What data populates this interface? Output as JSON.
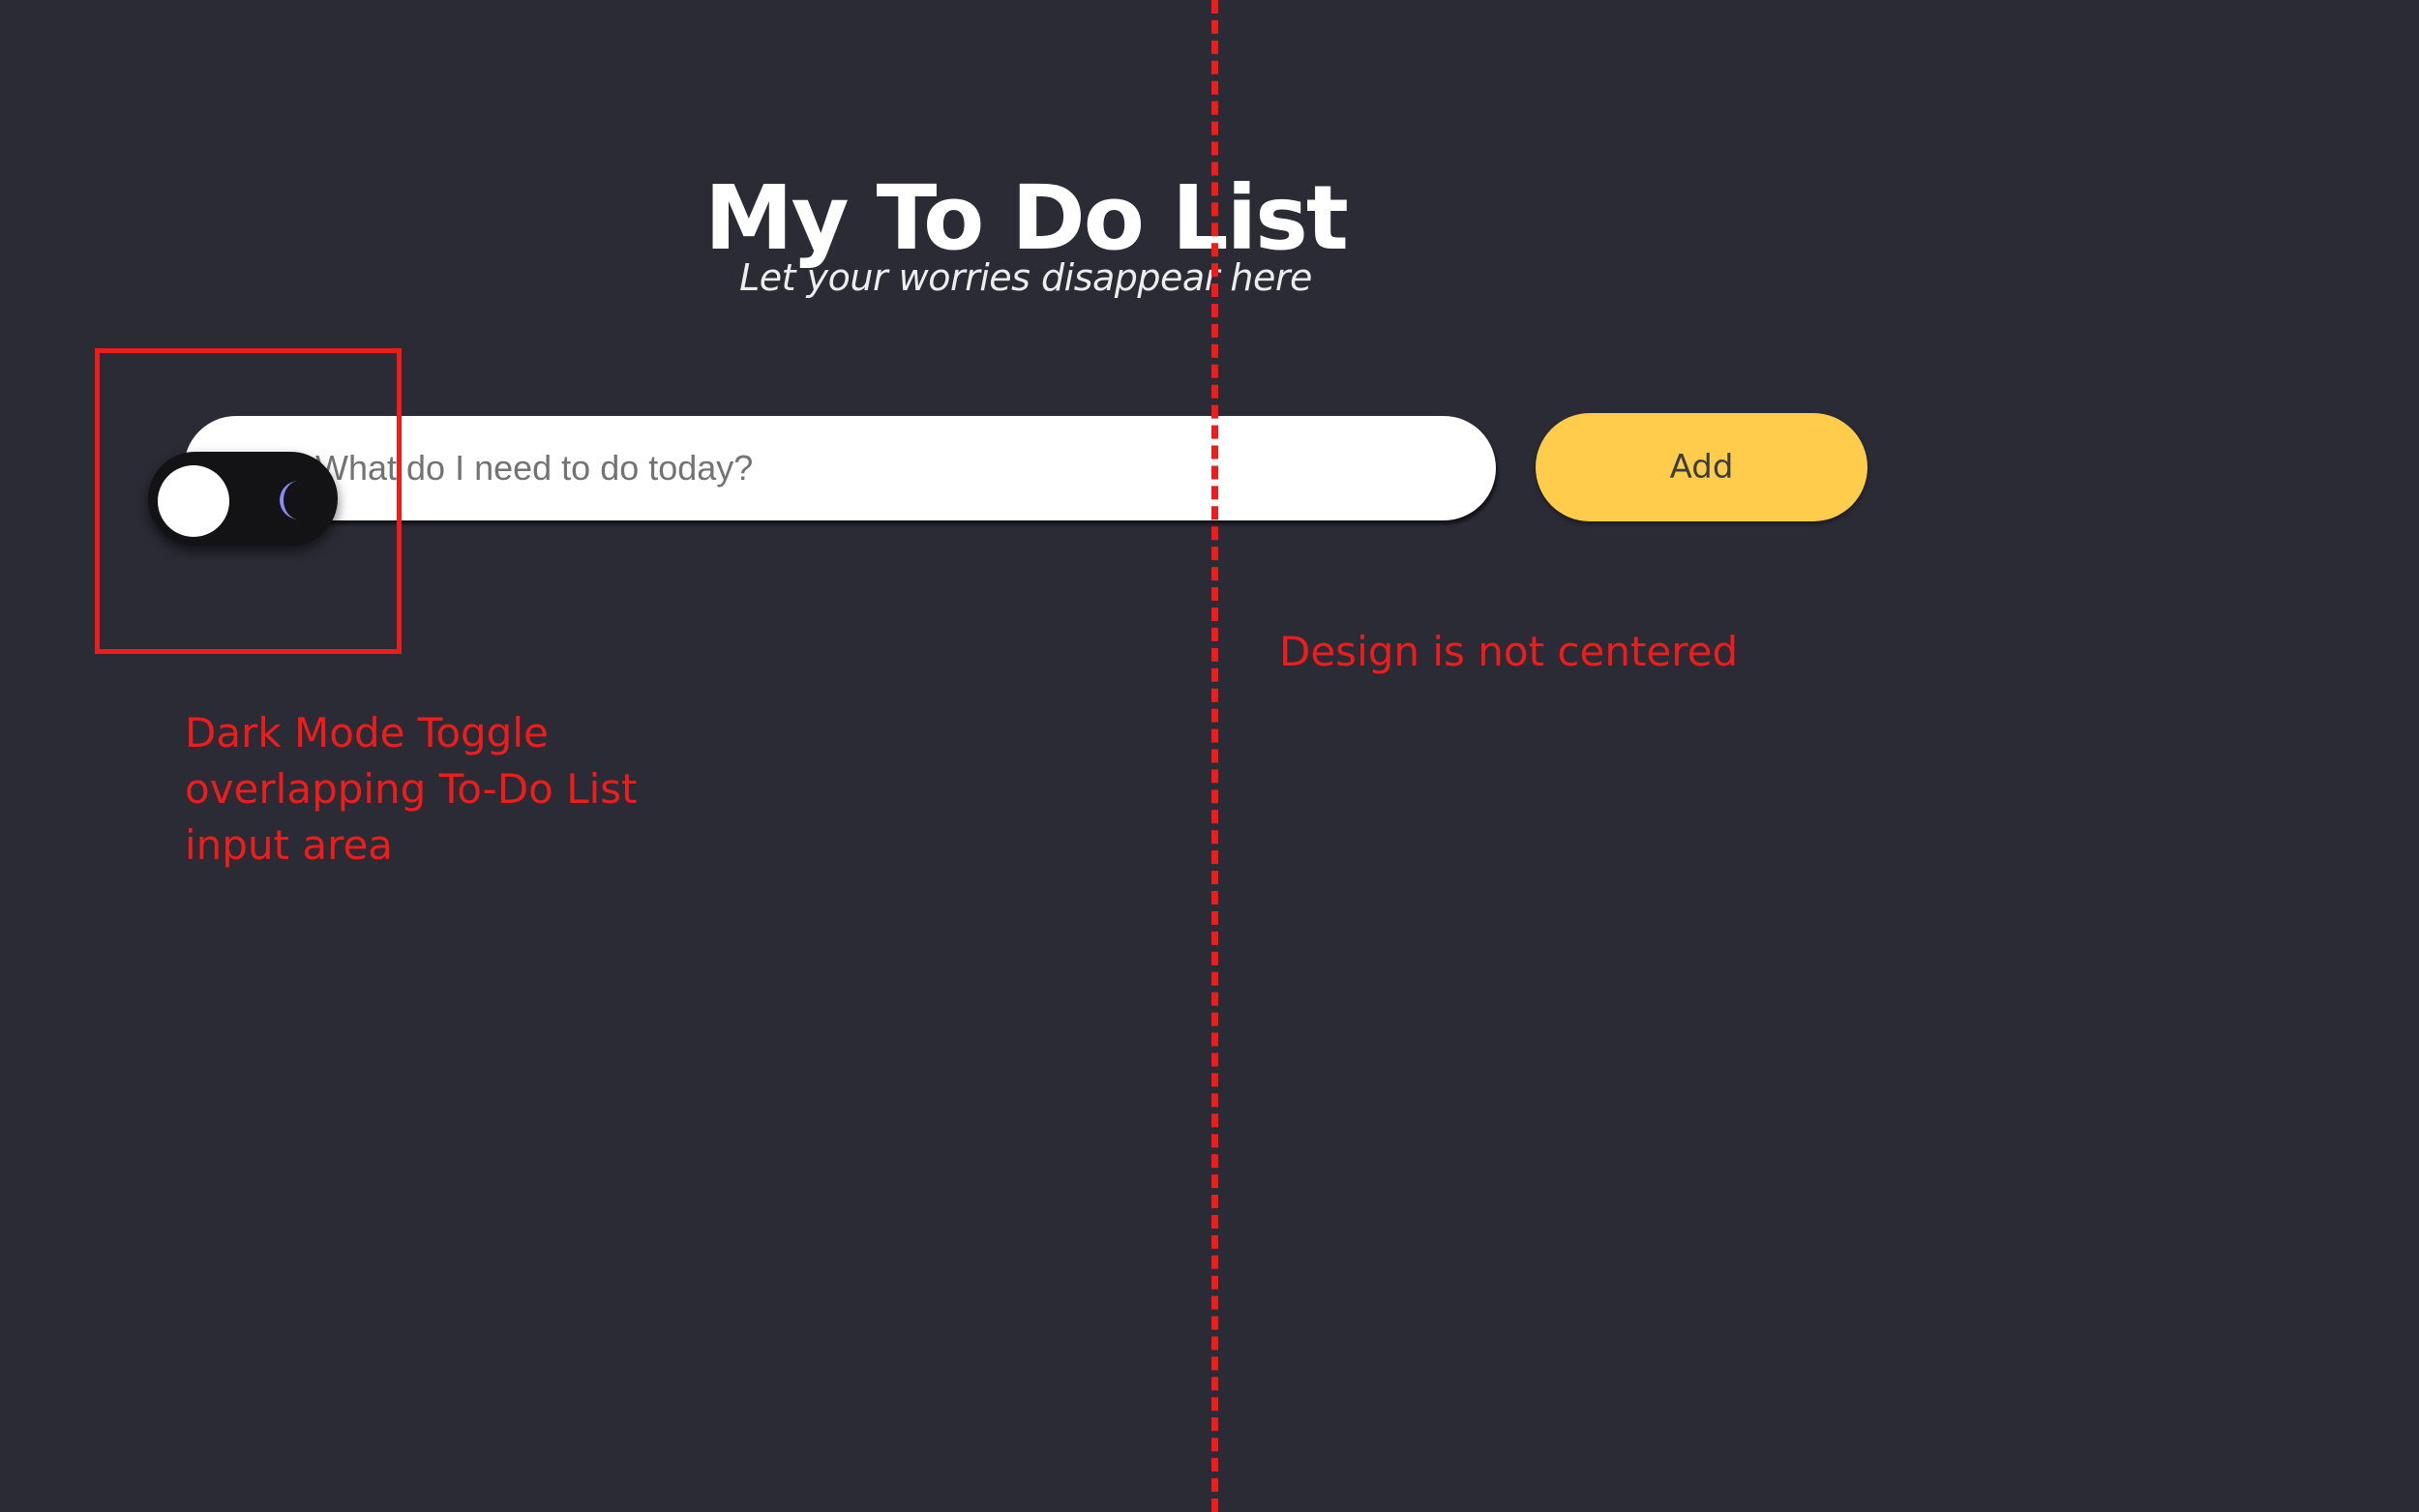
{
  "header": {
    "title": "My To Do List",
    "subtitle": "Let your worries disappear here"
  },
  "todo_form": {
    "input_placeholder": "What do I need to do today?",
    "input_value": "",
    "add_label": "Add",
    "add_color": "#ffcc4b"
  },
  "dark_mode_toggle": {
    "state": "dark",
    "knob_icon": "circle-knob",
    "icon": "moon-icon",
    "icon_color": "#8b8cf3"
  },
  "annotations": {
    "toggle_note": "Dark Mode Toggle overlapping To-Do List input area",
    "center_note": "Design is not centered",
    "color": "#ef1c1c"
  },
  "theme": {
    "background": "#2a2b35",
    "toggle_background": "#131316"
  }
}
